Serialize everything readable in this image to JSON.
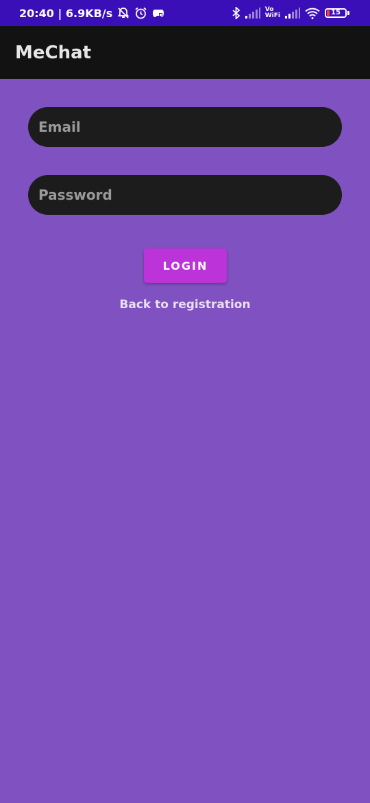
{
  "status_bar": {
    "time_speed": "20:40 | 6.9KB/s",
    "icons": [
      "muted-bell-icon",
      "alarm-icon",
      "game-controller-icon",
      "bluetooth-icon",
      "signal-icon",
      "vowifi-icon",
      "signal-icon",
      "wifi-icon",
      "battery-icon"
    ],
    "vowifi_top": "Vo",
    "vowifi_bottom": "WiFi",
    "battery": "15"
  },
  "app_bar": {
    "title": "MeChat"
  },
  "form": {
    "email_placeholder": "Email",
    "password_placeholder": "Password",
    "login_label": "LOGIN",
    "back_link": "Back to registration"
  },
  "colors": {
    "background": "#8052c1",
    "status_bar": "#3a0fb8",
    "app_bar": "#121212",
    "field": "#1c1c1c",
    "button": "#bb33d9"
  }
}
